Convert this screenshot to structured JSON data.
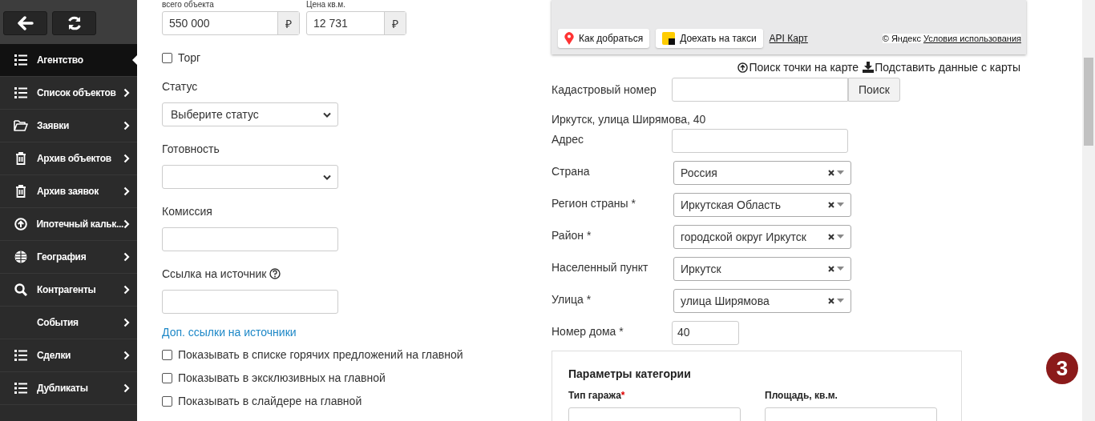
{
  "sidebar": {
    "items": [
      {
        "label": "Агентство",
        "kind": "list",
        "selected": true,
        "submenu": false
      },
      {
        "label": "Список объектов",
        "kind": "list",
        "selected": false,
        "submenu": true
      },
      {
        "label": "Заявки",
        "kind": "folder",
        "selected": false,
        "submenu": true
      },
      {
        "label": "Архив объектов",
        "kind": "trash",
        "selected": false,
        "submenu": true
      },
      {
        "label": "Архив заявок",
        "kind": "trash",
        "selected": false,
        "submenu": true
      },
      {
        "label": "Ипотечный кальк...",
        "kind": "upload",
        "selected": false,
        "submenu": true
      },
      {
        "label": "География",
        "kind": "globe",
        "selected": false,
        "submenu": true
      },
      {
        "label": "Контрагенты",
        "kind": "search",
        "selected": false,
        "submenu": true
      },
      {
        "label": "События",
        "kind": "plain",
        "selected": false,
        "submenu": true
      },
      {
        "label": "Сделки",
        "kind": "list",
        "selected": false,
        "submenu": true
      },
      {
        "label": "Дубликаты",
        "kind": "list",
        "selected": false,
        "submenu": true
      }
    ]
  },
  "prices": [
    {
      "label": "всего объекта",
      "value": "550 000",
      "currency": "₽"
    },
    {
      "label": "Цена кв.м.",
      "value": "12 731",
      "currency": "₽"
    }
  ],
  "bargain": {
    "label": "Торг",
    "checked": false
  },
  "status": {
    "label": "Статус",
    "value": "Выберите статус"
  },
  "readiness": {
    "label": "Готовность"
  },
  "commission": {
    "label": "Комиссия"
  },
  "source_link": {
    "label": "Ссылка на источник"
  },
  "extra_links": "Доп. ссылки на источники",
  "options": [
    {
      "label": "Показывать в списке горячих предложений на главной",
      "checked": false
    },
    {
      "label": "Показывать в эксклюзивных на главной",
      "checked": false
    },
    {
      "label": "Показывать в слайдере на главной",
      "checked": false
    }
  ],
  "map": {
    "buttons": [
      {
        "label": "Как добраться",
        "kind": "route"
      },
      {
        "label": "Доехать на такси",
        "kind": "taxi"
      }
    ],
    "api_link": "API Карт",
    "copyright": "© Яндекс",
    "terms_link": "Условия использования"
  },
  "map_actions": [
    {
      "label": "Поиск точки на карте",
      "kind": "find"
    },
    {
      "label": "Подставить данные с карты",
      "kind": "fill"
    }
  ],
  "cadastral": {
    "label": "Кадастровый номер",
    "button": "Поиск"
  },
  "address_line": "Иркутск, улица Ширямова, 40",
  "address_fields": [
    {
      "label": "Адрес",
      "kind": "input"
    },
    {
      "label": "Страна",
      "kind": "select",
      "value": "Россия"
    },
    {
      "label": "Регион страны *",
      "kind": "select",
      "value": "Иркутская Область"
    },
    {
      "label": "Район *",
      "kind": "select",
      "value": "городской округ Иркутск"
    },
    {
      "label": "Населенный пункт",
      "kind": "select",
      "value": "Иркутск"
    },
    {
      "label": "Улица *",
      "kind": "select",
      "value": "улица Ширямова"
    },
    {
      "label": "Номер дома *",
      "kind": "short",
      "value": "40"
    }
  ],
  "category": {
    "title": "Параметры категории",
    "fields": [
      {
        "label": "Тип гаража",
        "required": true,
        "required_mark": "*"
      },
      {
        "label": "Площадь, кв.м.",
        "required": false
      }
    ]
  },
  "badge": "3"
}
